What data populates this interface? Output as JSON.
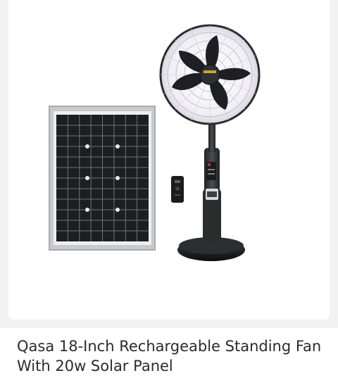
{
  "product": {
    "title": "Qasa 18-Inch Rechargeable Standing Fan With 20w Solar Panel",
    "image_icon": "product-photo-fan-solar-panel"
  },
  "colors": {
    "page_background": "#f2f2f2",
    "card_background": "#ffffff",
    "title_text": "#2b2b2b",
    "fan_body": "#2a2d2e",
    "solar_cell": "#1c1f22"
  }
}
